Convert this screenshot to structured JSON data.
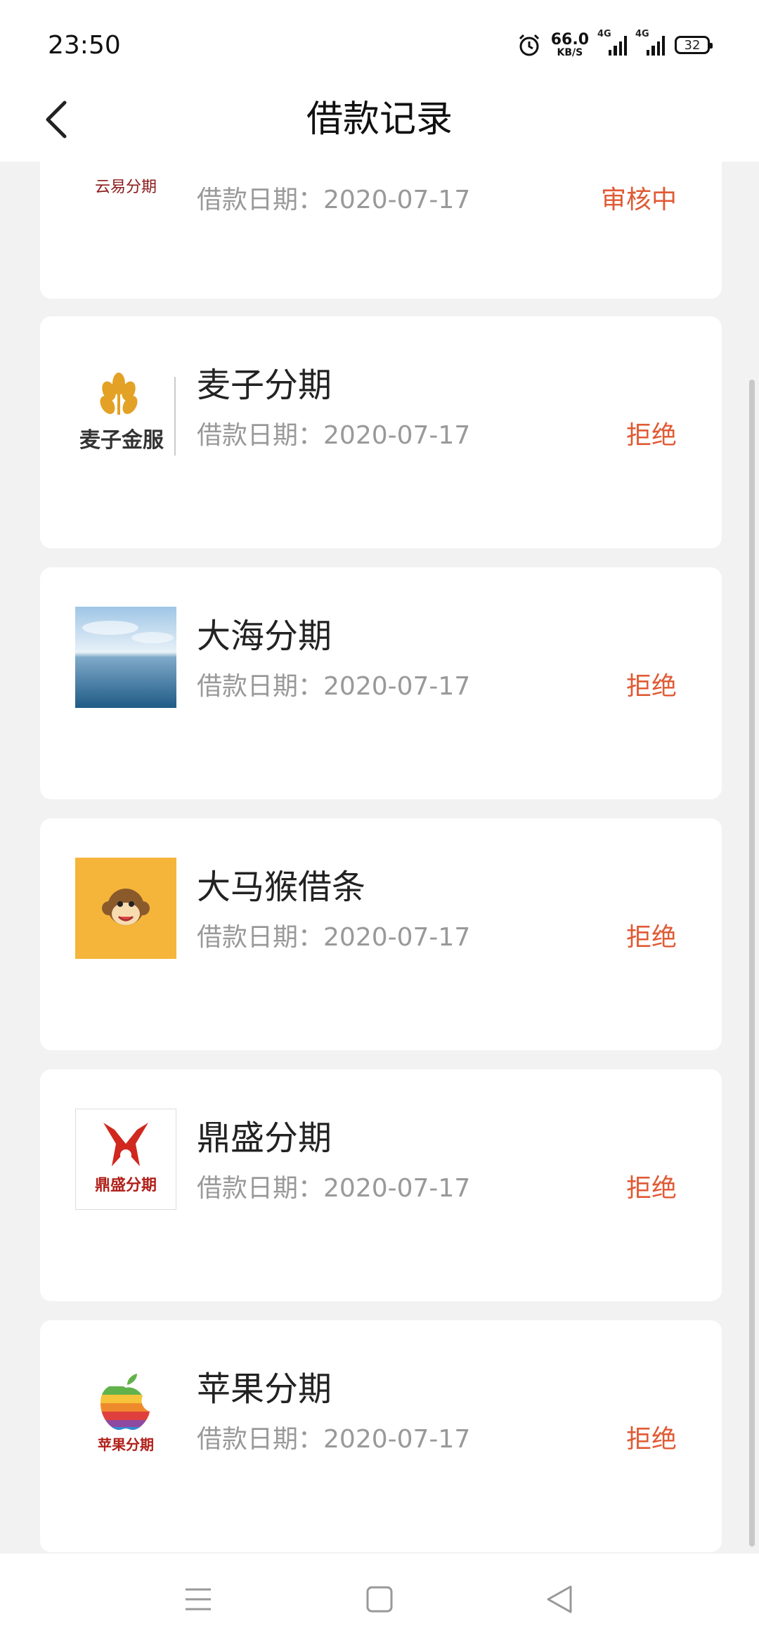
{
  "status_bar": {
    "time": "23:50",
    "net_speed_value": "66.0",
    "net_speed_unit": "KB/S",
    "sim1_label": "4G",
    "sim2_label": "4G",
    "battery": "32"
  },
  "header": {
    "title": "借款记录",
    "back_icon": "chevron-left-icon"
  },
  "records": [
    {
      "name": "",
      "logo_text": "云易分期",
      "date_label": "借款日期：",
      "date": "2020-07-17",
      "status": "审核中"
    },
    {
      "name": "麦子分期",
      "logo_text": "麦子金服",
      "date_label": "借款日期：",
      "date": "2020-07-17",
      "status": "拒绝"
    },
    {
      "name": "大海分期",
      "logo_text": "",
      "date_label": "借款日期：",
      "date": "2020-07-17",
      "status": "拒绝"
    },
    {
      "name": "大马猴借条",
      "logo_text": "",
      "date_label": "借款日期：",
      "date": "2020-07-17",
      "status": "拒绝"
    },
    {
      "name": "鼎盛分期",
      "logo_text": "鼎盛分期",
      "date_label": "借款日期：",
      "date": "2020-07-17",
      "status": "拒绝"
    },
    {
      "name": "苹果分期",
      "logo_text": "苹果分期",
      "date_label": "借款日期：",
      "date": "2020-07-17",
      "status": "拒绝"
    }
  ],
  "colors": {
    "status_text": "#e05a34",
    "date_text": "#999999",
    "background": "#f2f2f2",
    "card": "#ffffff"
  },
  "navbar": {
    "icons": [
      "menu-icon",
      "home-square-icon",
      "back-triangle-icon"
    ]
  }
}
